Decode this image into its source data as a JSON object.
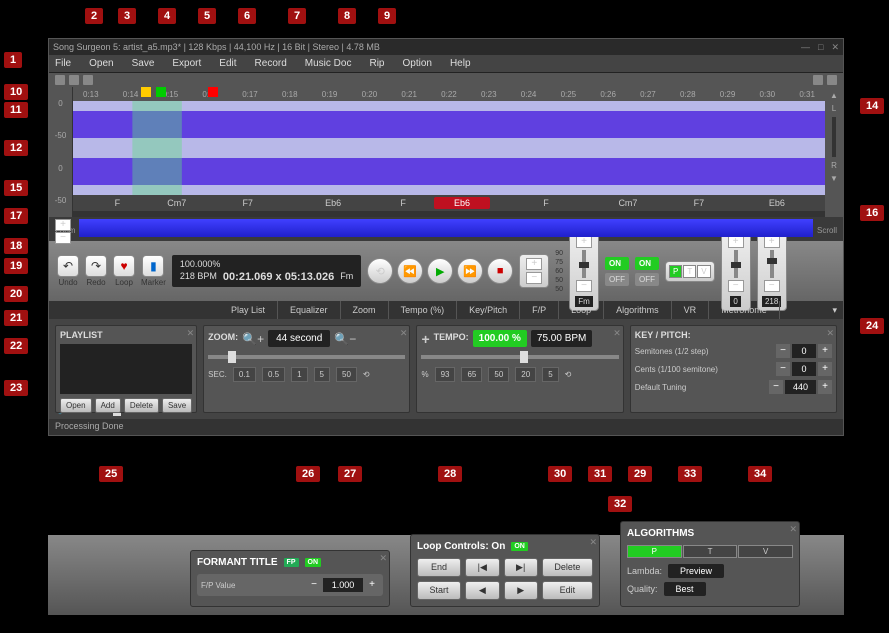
{
  "title": "Song Surgeon 5: artist_a5.mp3* | 128 Kbps | 44,100 Hz | 16 Bit | Stereo | 4.78 MB",
  "menu": [
    "File",
    "Open",
    "Save",
    "Export",
    "Edit",
    "Record",
    "Music Doc",
    "Rip",
    "Option",
    "Help"
  ],
  "ruler_left": [
    "0",
    "-50",
    "0",
    "-50"
  ],
  "timeline": [
    "0:13",
    "0:14",
    "0:15",
    "0:16",
    "0:17",
    "0:18",
    "0:19",
    "0:20",
    "0:21",
    "0:22",
    "0:23",
    "0:24",
    "0:25",
    "0:26",
    "0:27",
    "0:28",
    "0:29",
    "0:30",
    "0:31"
  ],
  "ruler_right_labels": [
    "L",
    "R"
  ],
  "chords": [
    {
      "pos": 5,
      "t": "F"
    },
    {
      "pos": 12,
      "t": "Cm7"
    },
    {
      "pos": 22,
      "t": "F7"
    },
    {
      "pos": 33,
      "t": "Eb6"
    },
    {
      "pos": 43,
      "t": "F"
    },
    {
      "pos": 50,
      "t": "Eb6",
      "hl": true
    },
    {
      "pos": 62,
      "t": "F"
    },
    {
      "pos": 72,
      "t": "Cm7"
    },
    {
      "pos": 82,
      "t": "F7"
    },
    {
      "pos": 92,
      "t": "Eb6"
    }
  ],
  "zoom_label": "Zoom",
  "scroll_label": "Scroll",
  "ctrl_btns": {
    "undo": "Undo",
    "redo": "Redo",
    "loop": "Loop",
    "marker": "Marker"
  },
  "info": {
    "line1": "100.000%",
    "line2": "218 BPM",
    "time": "00:21.069 x 05:13.026",
    "key": "Fm"
  },
  "volume": "55%",
  "tempo_ctrl": {
    "top": "90",
    "vals": [
      "75",
      "60",
      "50"
    ],
    "bottom": "50",
    "key": "Fm"
  },
  "tabs": [
    "Play List",
    "Equalizer",
    "Zoom",
    "Tempo (%)",
    "Key/Pitch",
    "F/P",
    "Loop",
    "Algorithms",
    "VR",
    "Metronome"
  ],
  "vr_val": "0",
  "metro_val": "218",
  "playlist": {
    "title": "PLAYLIST",
    "btns": [
      "Open",
      "Add",
      "Delete",
      "Save"
    ]
  },
  "zoom_panel": {
    "title": "ZOOM:",
    "disp": "44 second",
    "sec_label": "SEC.",
    "secs": [
      "0.1",
      "0.5",
      "1",
      "5",
      "50"
    ]
  },
  "tempo_panel": {
    "title": "TEMPO:",
    "pct": "100.00 %",
    "bpm": "75.00 BPM",
    "pct_label": "%",
    "pcts": [
      "93",
      "65",
      "50",
      "20",
      "5"
    ]
  },
  "key_panel": {
    "title": "KEY / PITCH:",
    "rows": [
      {
        "label": "Semitones (1/2 step)",
        "val": "0"
      },
      {
        "label": "Cents (1/100 semitone)",
        "val": "0"
      },
      {
        "label": "Default Tuning",
        "val": "440"
      }
    ]
  },
  "status": "Processing Done",
  "formant": {
    "title": "FORMANT TITLE",
    "on": "ON",
    "fp": "FP",
    "label": "F/P Value",
    "val": "1.000"
  },
  "loop_detached": {
    "title": "Loop Controls: On",
    "on": "ON",
    "btns": [
      "End",
      "|◀",
      "▶|",
      "Delete",
      "Start",
      "◀",
      "▶",
      "Edit"
    ]
  },
  "alg": {
    "title": "ALGORITHMS",
    "tabs": [
      "P",
      "T",
      "V"
    ],
    "lambda_label": "Lambda:",
    "lambda": "Preview",
    "quality_label": "Quality:",
    "quality": "Best"
  },
  "callouts": {
    "1": "1",
    "2": "2",
    "3": "3",
    "4": "4",
    "5": "5",
    "6": "6",
    "7": "7",
    "8": "8",
    "9": "9",
    "10": "10",
    "11": "11",
    "12": "12",
    "13": "",
    "14": "14",
    "15": "15",
    "16": "16",
    "17": "17",
    "18": "18",
    "19": "19",
    "20": "20",
    "21": "21",
    "22": "22",
    "23": "23",
    "24": "24",
    "25": "25",
    "26": "26",
    "27": "27",
    "28": "28",
    "29": "29",
    "30": "30",
    "31": "31",
    "32": "32",
    "33": "33",
    "34": "34"
  }
}
